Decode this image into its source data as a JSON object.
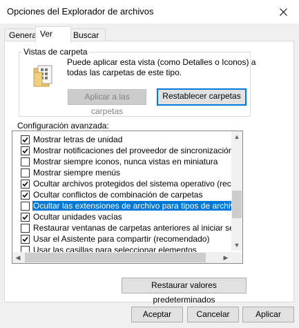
{
  "window": {
    "title": "Opciones del Explorador de archivos"
  },
  "tabs": [
    {
      "label": "General"
    },
    {
      "label": "Ver"
    },
    {
      "label": "Buscar"
    }
  ],
  "folder_views": {
    "group_label": "Vistas de carpeta",
    "description_line1": "Puede aplicar esta vista (como Detalles o Iconos) a",
    "description_line2": "todas las carpetas de este tipo.",
    "apply_button": "Aplicar a las carpetas",
    "reset_button": "Restablecer carpetas"
  },
  "advanced": {
    "label": "Configuración avanzada:",
    "items": [
      {
        "label": "Mostrar letras de unidad",
        "checked": true
      },
      {
        "label": "Mostrar notificaciones del proveedor de sincronización",
        "checked": true
      },
      {
        "label": "Mostrar siempre iconos, nunca vistas en miniatura",
        "checked": false
      },
      {
        "label": "Mostrar siempre menús",
        "checked": false
      },
      {
        "label": "Ocultar archivos protegidos del sistema operativo (recome",
        "checked": true
      },
      {
        "label": "Ocultar conflictos de combinación de carpetas",
        "checked": true
      },
      {
        "label": "Ocultar las extensiones de archivo para tipos de archivo c",
        "checked": false,
        "selected": true
      },
      {
        "label": "Ocultar unidades vacías",
        "checked": true
      },
      {
        "label": "Restaurar ventanas de carpetas anteriores al iniciar sesió",
        "checked": false
      },
      {
        "label": "Usar el Asistente para compartir (recomendado)",
        "checked": true
      },
      {
        "label": "Usar las casillas para seleccionar elementos",
        "checked": false
      }
    ],
    "restore_defaults_button": "Restaurar valores predeterminados"
  },
  "footer": {
    "ok_button": "Aceptar",
    "cancel_button": "Cancelar",
    "apply_button": "Aplicar"
  }
}
